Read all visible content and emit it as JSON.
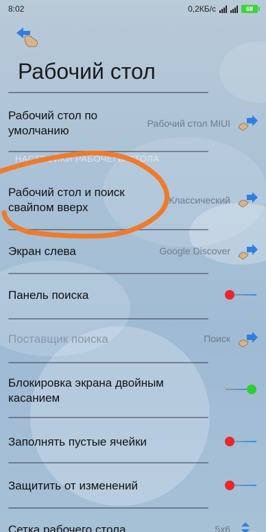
{
  "status_bar": {
    "time": "8:02",
    "network_speed": "0,2КБ/с",
    "battery": "68"
  },
  "header": {
    "back_icon": "back-arrow-icon",
    "title": "Рабочий стол"
  },
  "section_hint": "НАСТРОЙКИ РАБОЧЕГО СТОЛА",
  "settings": [
    {
      "label": "Рабочий стол по умолчанию",
      "value": "Рабочий стол MIUI",
      "type": "select"
    },
    {
      "label": "Рабочий стол и поиск свайпом вверх",
      "value": "Классический",
      "type": "select"
    },
    {
      "label": "Экран слева",
      "value": "Google Discover",
      "type": "select"
    },
    {
      "label": "Панель поиска",
      "type": "toggle",
      "enabled": false
    },
    {
      "label": "Поставщик поиска",
      "value": "Поиск",
      "type": "select",
      "disabled": true
    },
    {
      "label": "Блокировка экрана двойным касанием",
      "type": "toggle",
      "enabled": true
    },
    {
      "label": "Заполнять пустые ячейки",
      "type": "toggle",
      "enabled": false
    },
    {
      "label": "Защитить от изменений",
      "type": "toggle",
      "enabled": false
    },
    {
      "label": "Сетка рабочего стола",
      "value": "5x6",
      "type": "select"
    }
  ],
  "colors": {
    "toggle_off": "#e8262b",
    "toggle_on": "#2ecf2e",
    "annotation": "#f07a2a"
  }
}
